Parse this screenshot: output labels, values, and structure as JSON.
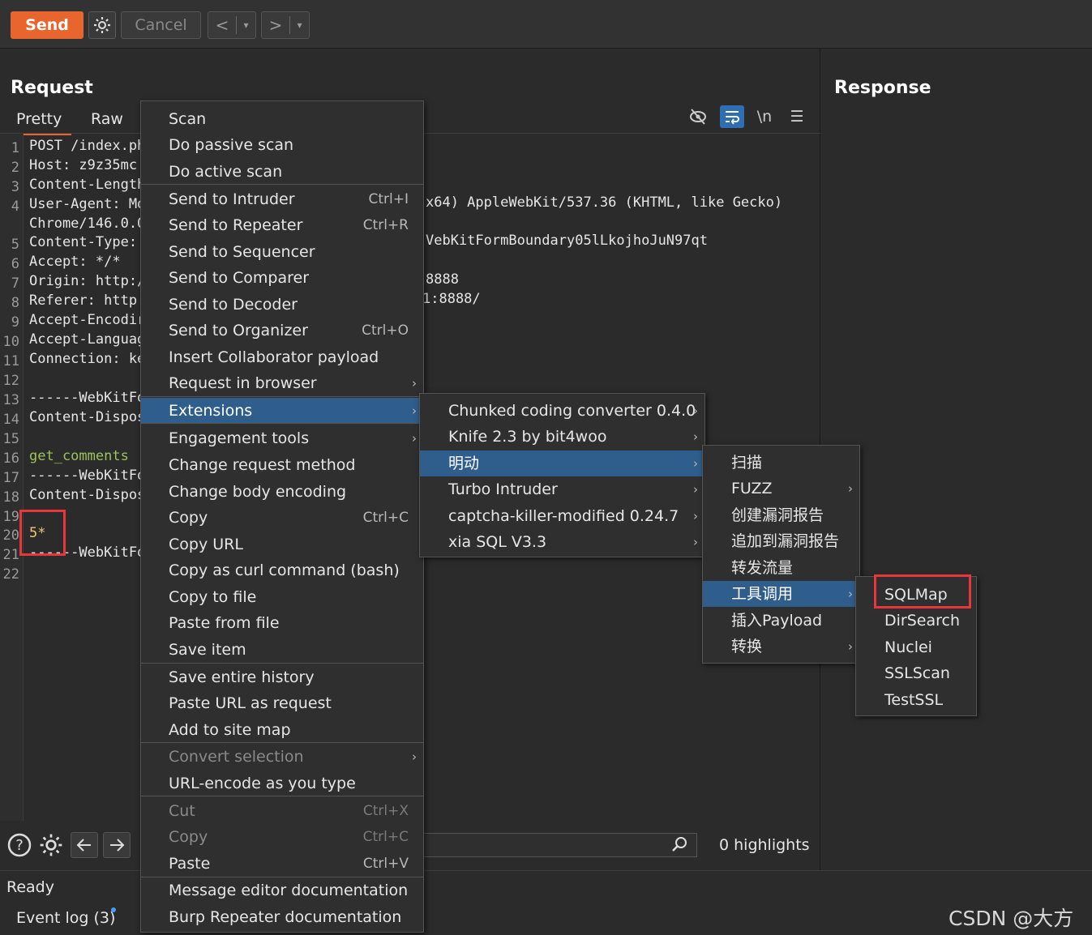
{
  "toolbar": {
    "send_label": "Send",
    "cancel_label": "Cancel",
    "back_label": "<",
    "forward_label": ">",
    "dropdown_label": "▾"
  },
  "request": {
    "title": "Request",
    "tabs": [
      "Pretty",
      "Raw"
    ],
    "active_tab": "Pretty",
    "line_numbers": [
      "1",
      "2",
      "3",
      "4",
      "",
      "5",
      "6",
      "7",
      "8",
      "9",
      "10",
      "11",
      "12",
      "13",
      "14",
      "15",
      "16",
      "17",
      "18",
      "19",
      "20",
      "21",
      "22"
    ],
    "lines_left": [
      "POST /index.ph",
      "Host: z9z35mc.",
      "Content-Length",
      "User-Agent: Mo",
      "Chrome/146.0.0",
      "Content-Type:",
      "Accept: */*",
      "Origin: http:/",
      "Referer: http:",
      "Accept-Encodir",
      "Accept-Languag",
      "Connection: ke",
      "",
      "------WebKitFo",
      "Content-Dispos",
      "",
      "get_comments",
      "------WebKitFo",
      "Content-Dispos",
      "",
      "5*",
      "------WebKitFo",
      ""
    ],
    "lines_right": {
      "user_agent_tail": "x64) AppleWebKit/537.36 (KHTML, like Gecko)",
      "content_type_tail": "VebKitFormBoundary05lLkojhoJuN97qt",
      "origin_tail": "8888",
      "referer_tail": "1:8888/"
    }
  },
  "response": {
    "title": "Response"
  },
  "bottom": {
    "highlights": "0 highlights"
  },
  "status": {
    "ready": "Ready",
    "event_log": "Event log (3)",
    "watermark": "CSDN @大方子"
  },
  "context_menu": {
    "items": [
      {
        "label": "Scan"
      },
      {
        "label": "Do passive scan"
      },
      {
        "label": "Do active scan"
      },
      {
        "label": "Send to Intruder",
        "shortcut": "Ctrl+I"
      },
      {
        "label": "Send to Repeater",
        "shortcut": "Ctrl+R"
      },
      {
        "label": "Send to Sequencer"
      },
      {
        "label": "Send to Comparer"
      },
      {
        "label": "Send to Decoder"
      },
      {
        "label": "Send to Organizer",
        "shortcut": "Ctrl+O"
      },
      {
        "label": "Insert Collaborator payload"
      },
      {
        "label": "Request in browser",
        "submenu": true
      },
      {
        "label": "Extensions",
        "submenu": true,
        "selected": true
      },
      {
        "label": "Engagement tools",
        "submenu": true
      },
      {
        "label": "Change request method"
      },
      {
        "label": "Change body encoding"
      },
      {
        "label": "Copy",
        "shortcut": "Ctrl+C"
      },
      {
        "label": "Copy URL"
      },
      {
        "label": "Copy as curl command (bash)"
      },
      {
        "label": "Copy to file"
      },
      {
        "label": "Paste from file"
      },
      {
        "label": "Save item"
      },
      {
        "label": "Save entire history"
      },
      {
        "label": "Paste URL as request"
      },
      {
        "label": "Add to site map"
      },
      {
        "label": "Convert selection",
        "submenu": true,
        "disabled": true
      },
      {
        "label": "URL-encode as you type"
      },
      {
        "label": "Cut",
        "shortcut": "Ctrl+X",
        "disabled": true
      },
      {
        "label": "Copy",
        "shortcut": "Ctrl+C",
        "disabled": true
      },
      {
        "label": "Paste",
        "shortcut": "Ctrl+V"
      },
      {
        "label": "Message editor documentation"
      },
      {
        "label": "Burp Repeater documentation"
      }
    ]
  },
  "extensions_menu": {
    "items": [
      {
        "label": "Chunked coding converter 0.4.0"
      },
      {
        "label": "Knife 2.3 by bit4woo"
      },
      {
        "label": "明动",
        "selected": true
      },
      {
        "label": "Turbo Intruder"
      },
      {
        "label": "captcha-killer-modified 0.24.7"
      },
      {
        "label": "xia SQL V3.3"
      }
    ]
  },
  "mingdong_menu": {
    "items": [
      {
        "label": "扫描"
      },
      {
        "label": "FUZZ",
        "submenu": true
      },
      {
        "label": "创建漏洞报告"
      },
      {
        "label": "追加到漏洞报告"
      },
      {
        "label": "转发流量"
      },
      {
        "label": "工具调用",
        "submenu": true,
        "selected": true
      },
      {
        "label": "插入Payload"
      },
      {
        "label": "转换",
        "submenu": true
      }
    ]
  },
  "tools_menu": {
    "items": [
      {
        "label": "SQLMap",
        "highlighted": true
      },
      {
        "label": "DirSearch"
      },
      {
        "label": "Nuclei"
      },
      {
        "label": "SSLScan"
      },
      {
        "label": "TestSSL"
      }
    ]
  },
  "colors": {
    "accent": "#e8662d",
    "selection": "#2f5d8c",
    "highlight_box": "#e8363a",
    "icon_active": "#2f6db5"
  }
}
